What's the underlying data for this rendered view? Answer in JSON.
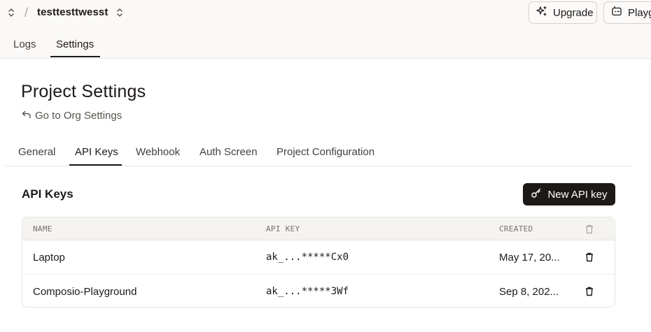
{
  "header": {
    "project_name": "testtesttwesst",
    "separator": "/",
    "upgrade_label": "Upgrade",
    "playground_label": "Playg",
    "tabs": [
      {
        "label": "Logs",
        "active": false
      },
      {
        "label": "Settings",
        "active": true
      }
    ]
  },
  "page": {
    "title": "Project Settings",
    "back_link": "Go to Org Settings",
    "tabs": [
      {
        "label": "General",
        "active": false
      },
      {
        "label": "API Keys",
        "active": true
      },
      {
        "label": "Webhook",
        "active": false
      },
      {
        "label": "Auth Screen",
        "active": false
      },
      {
        "label": "Project Configuration",
        "active": false
      }
    ]
  },
  "api_keys": {
    "section_title": "API Keys",
    "new_button_label": "New API key",
    "columns": {
      "name": "NAME",
      "api_key": "API KEY",
      "created": "CREATED"
    },
    "rows": [
      {
        "name": "Laptop",
        "api_key": "ak_...*****Cx0",
        "created": "May 17, 20..."
      },
      {
        "name": "Composio-Playground",
        "api_key": "ak_...*****3Wf",
        "created": "Sep 8, 202..."
      }
    ]
  },
  "icons": {
    "project_switcher": "chevrons-up-down-icon",
    "upgrade": "sparkles-icon",
    "playground": "bot-icon",
    "back": "undo-arrow-icon",
    "new_key": "key-icon",
    "delete": "trash-icon"
  },
  "colors": {
    "primary_button": "#1c1917",
    "topbar_bg": "#faf9f7",
    "table_header_bg": "#f5f3f0"
  }
}
